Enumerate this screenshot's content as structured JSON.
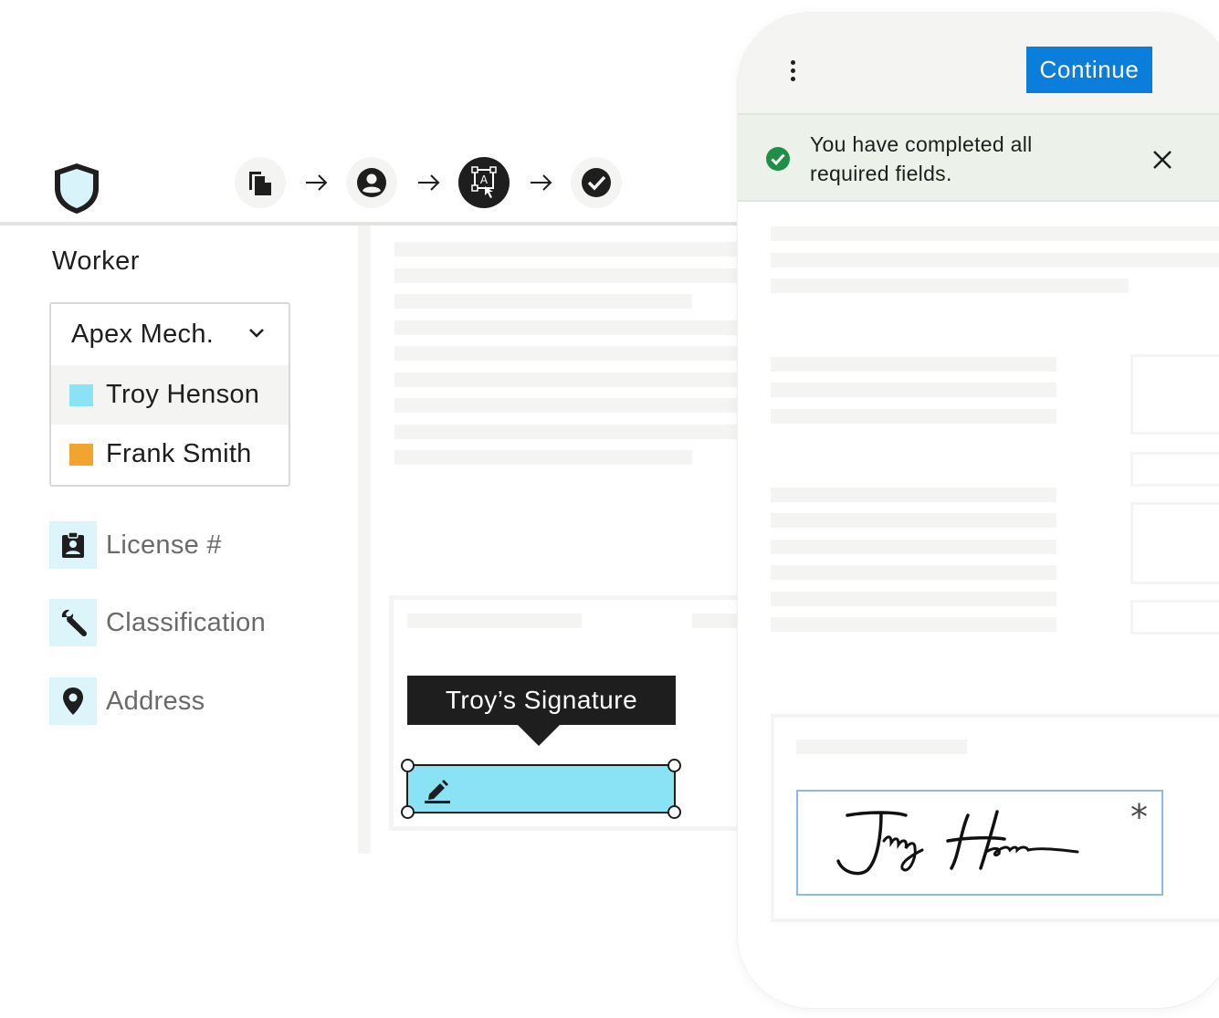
{
  "workflow": {
    "logo_icon": "shield-icon",
    "steps": [
      {
        "icon": "documents-icon",
        "state": "done"
      },
      {
        "icon": "user-icon",
        "state": "done"
      },
      {
        "icon": "signature-tag-icon",
        "state": "active"
      },
      {
        "icon": "check-circle-icon",
        "state": "pending"
      }
    ]
  },
  "sidebar": {
    "worker_label": "Worker",
    "company_select": {
      "selected": "Apex Mech.",
      "options": [
        {
          "label": "Troy Henson",
          "color": "#8ae3f5",
          "selected": true
        },
        {
          "label": "Frank Smith",
          "color": "#f2a431",
          "selected": false
        }
      ]
    },
    "fields": [
      {
        "label": "License #",
        "icon": "id-badge-icon"
      },
      {
        "label": "Classification",
        "icon": "wrench-icon"
      },
      {
        "label": "Address",
        "icon": "location-pin-icon"
      }
    ]
  },
  "document": {
    "tooltip": "Troy’s Signature",
    "signature_field_color": "#8ae3f5"
  },
  "mobile": {
    "continue_label": "Continue",
    "alert_text": "You have completed all required fields.",
    "required_marker": "*",
    "accent": "#0b7ddb",
    "success_color": "#1f8f47"
  }
}
